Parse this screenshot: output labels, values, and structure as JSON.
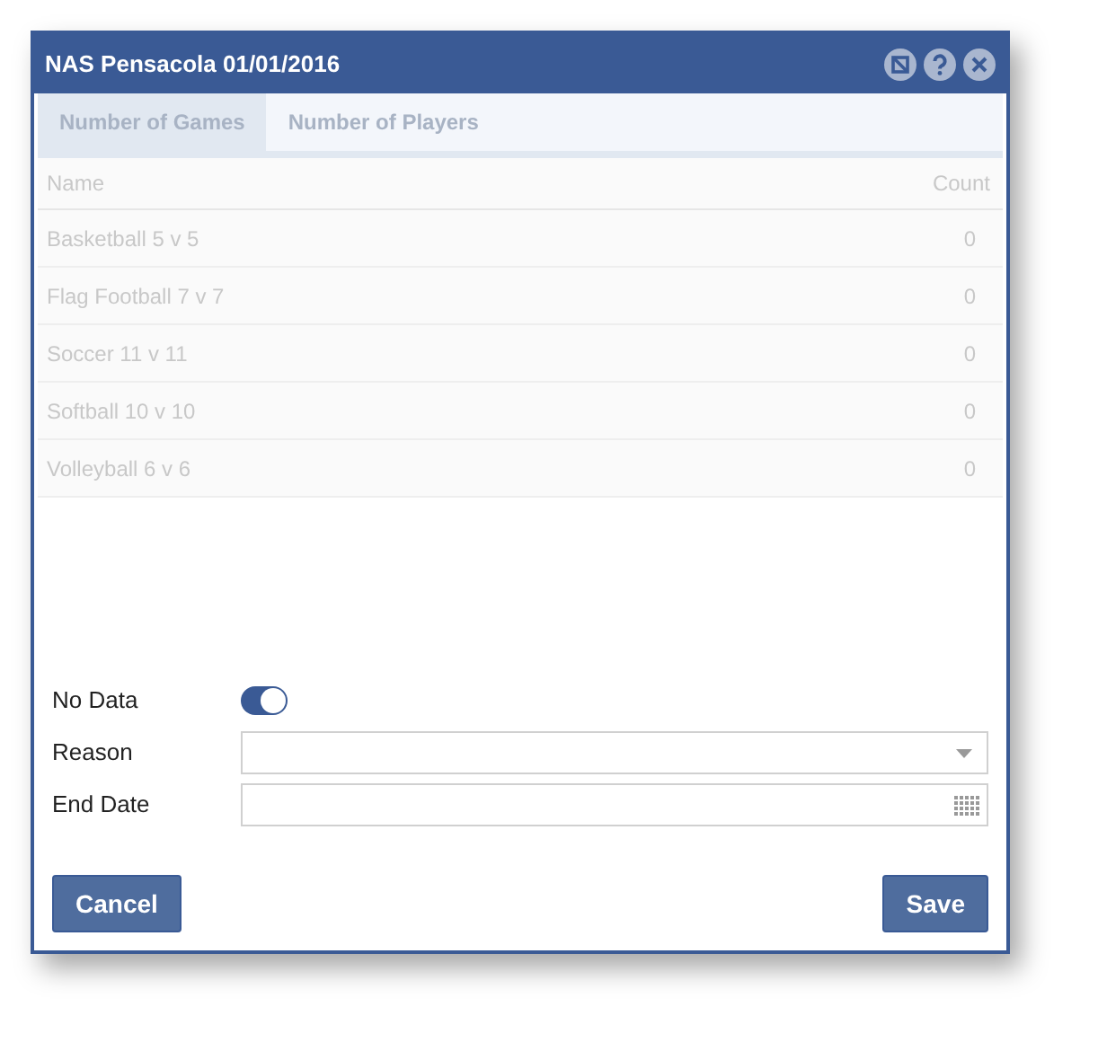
{
  "window": {
    "title": "NAS Pensacola 01/01/2016"
  },
  "tabs": [
    {
      "label": "Number of Games",
      "selected": true
    },
    {
      "label": "Number of Players",
      "selected": false
    }
  ],
  "table": {
    "disabled": true,
    "columns": [
      "Name",
      "Count"
    ],
    "rows": [
      {
        "name": "Basketball 5 v 5",
        "count": "0"
      },
      {
        "name": "Flag Football 7 v 7",
        "count": "0"
      },
      {
        "name": "Soccer 11 v 11",
        "count": "0"
      },
      {
        "name": "Softball 10 v 10",
        "count": "0"
      },
      {
        "name": "Volleyball 6 v 6",
        "count": "0"
      }
    ]
  },
  "form": {
    "no_data": {
      "label": "No Data",
      "on": true
    },
    "reason": {
      "label": "Reason"
    },
    "end_date": {
      "label": "End Date"
    }
  },
  "buttons": {
    "cancel": "Cancel",
    "save": "Save"
  }
}
